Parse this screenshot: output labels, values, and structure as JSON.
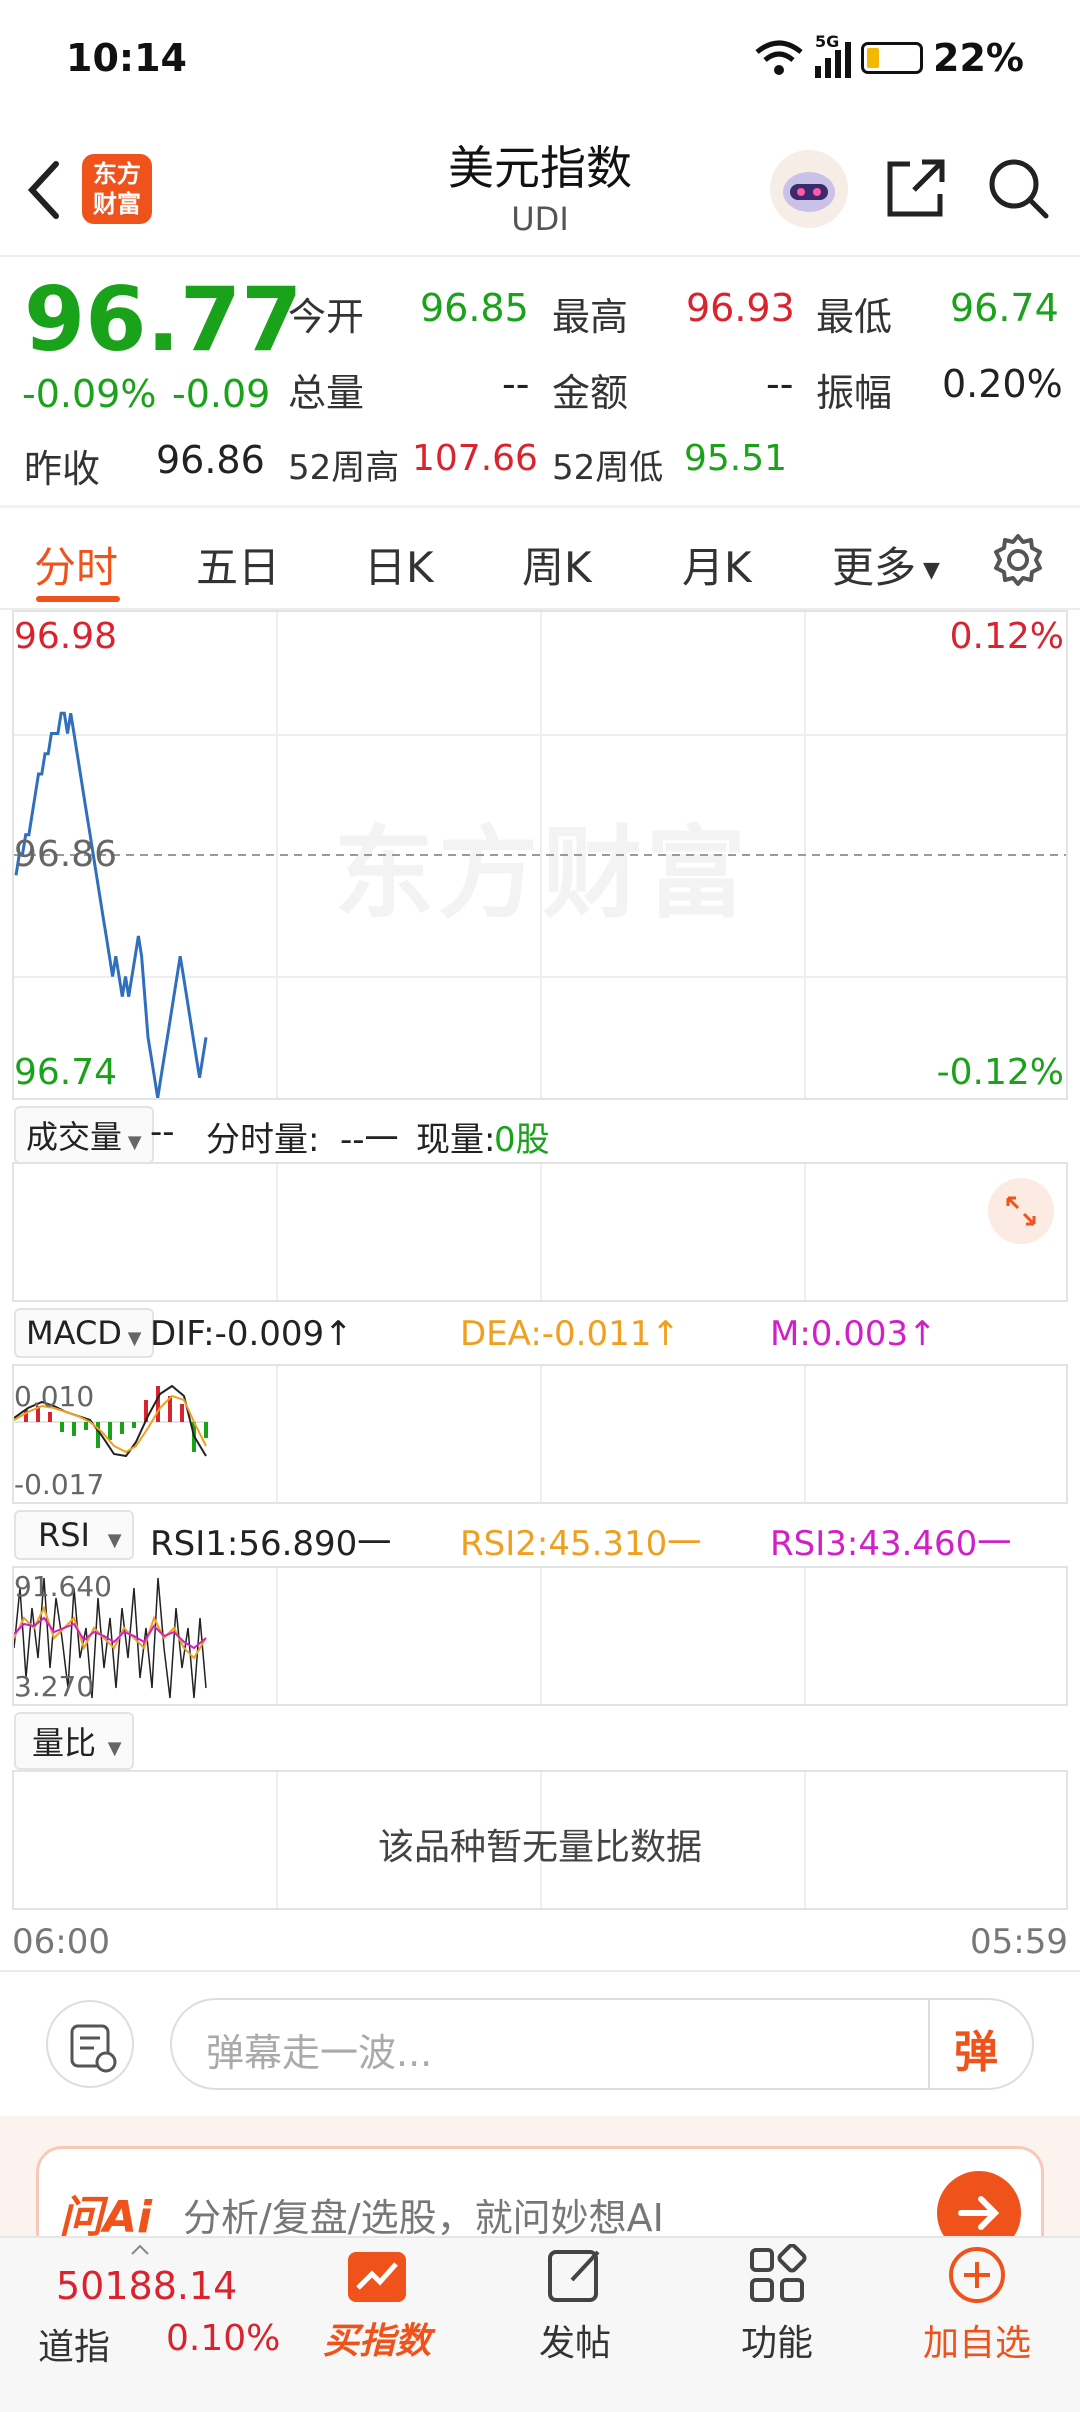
{
  "status": {
    "time": "10:14",
    "signal": "5G",
    "battery": "22%"
  },
  "header": {
    "title": "美元指数",
    "code": "UDI",
    "logo_text": "东方财富"
  },
  "quote": {
    "price": "96.77",
    "change_pct": "-0.09%",
    "change": "-0.09",
    "open_label": "今开",
    "open": "96.85",
    "high_label": "最高",
    "high": "96.93",
    "low_label": "最低",
    "low": "96.74",
    "volume_label": "总量",
    "volume": "--",
    "amount_label": "金额",
    "amount": "--",
    "amplitude_label": "振幅",
    "amplitude": "0.20%",
    "prev_close_label": "昨收",
    "prev_close": "96.86",
    "w52_high_label": "52周高",
    "w52_high": "107.66",
    "w52_low_label": "52周低",
    "w52_low": "95.51"
  },
  "tabs": [
    {
      "label": "分时",
      "active": true
    },
    {
      "label": "五日"
    },
    {
      "label": "日K"
    },
    {
      "label": "周K"
    },
    {
      "label": "月K"
    },
    {
      "label": "更多"
    }
  ],
  "chart": {
    "y_top": "96.98",
    "y_mid": "96.86",
    "y_bottom": "96.74",
    "pct_top": "0.12%",
    "pct_bottom": "-0.12%",
    "watermark": "东方财富"
  },
  "chart_data": {
    "type": "line",
    "ylim": [
      96.74,
      96.98
    ],
    "reference": 96.86,
    "x": [
      0,
      1,
      2,
      3,
      4,
      5,
      6,
      7,
      8,
      9,
      10,
      11,
      12,
      13,
      14,
      15,
      16,
      17,
      18,
      19,
      20,
      21,
      22,
      23,
      24,
      25,
      26,
      27,
      28,
      29,
      30,
      31,
      32,
      33,
      34,
      35,
      36,
      37,
      38,
      39,
      40,
      41,
      42,
      43,
      44,
      45,
      46,
      47,
      48,
      49,
      50,
      51,
      52,
      53,
      54,
      55,
      56,
      57,
      58,
      59
    ],
    "values": [
      96.85,
      96.86,
      96.86,
      96.87,
      96.87,
      96.88,
      96.89,
      96.9,
      96.9,
      96.91,
      96.91,
      96.92,
      96.92,
      96.92,
      96.93,
      96.93,
      96.92,
      96.93,
      96.92,
      96.91,
      96.9,
      96.89,
      96.88,
      96.87,
      96.86,
      96.85,
      96.84,
      96.83,
      96.82,
      96.81,
      96.8,
      96.81,
      96.8,
      96.79,
      96.8,
      96.79,
      96.8,
      96.81,
      96.82,
      96.81,
      96.79,
      96.77,
      96.76,
      96.75,
      96.74,
      96.75,
      96.76,
      96.77,
      96.78,
      96.79,
      96.8,
      96.81,
      96.8,
      96.79,
      96.78,
      96.77,
      96.76,
      96.75,
      96.76,
      96.77
    ]
  },
  "volume_panel": {
    "selector": "成交量",
    "dash": "--",
    "min_vol_label": "分时量:",
    "min_vol": "--一",
    "cur_vol_label": "现量:",
    "cur_vol": "0股"
  },
  "macd": {
    "selector": "MACD",
    "dif": "DIF:-0.009↑",
    "dea": "DEA:-0.011↑",
    "m": "M:0.003↑",
    "top": "0.010",
    "bottom": "-0.017"
  },
  "rsi": {
    "selector": "RSI",
    "rsi1": "RSI1:56.890一",
    "rsi2": "RSI2:45.310一",
    "rsi3": "RSI3:43.460一",
    "top": "91.640",
    "bottom": "3.270"
  },
  "ratio": {
    "selector": "量比",
    "empty": "该品种暂无量比数据"
  },
  "time_axis": {
    "start": "06:00",
    "end": "05:59"
  },
  "danmu": {
    "placeholder": "弹幕走一波...",
    "send": "弹"
  },
  "ai_bar": {
    "brand": "问Ai",
    "placeholder": "分析/复盘/选股，就问妙想AI"
  },
  "bottom_nav": {
    "index_value": "50188.14",
    "index_name": "道指",
    "index_change": "0.10%",
    "buy_label": "买指数",
    "post_label": "发帖",
    "func_label": "功能",
    "add_label": "加自选"
  },
  "colors": {
    "accent": "#f0521b",
    "up": "#d9232e",
    "down": "#1aa21a",
    "line": "#2f6fbd"
  }
}
